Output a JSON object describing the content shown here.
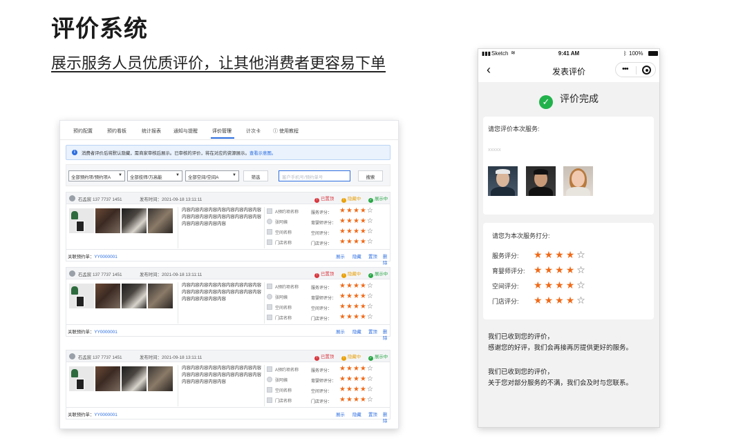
{
  "page": {
    "title": "评价系统",
    "subtitle": "展示服务人员优质评价，让其他消费者更容易下单"
  },
  "desktop": {
    "tabs": [
      {
        "label": "预约配置"
      },
      {
        "label": "预约看板"
      },
      {
        "label": "统计报表"
      },
      {
        "label": "通知与提醒"
      },
      {
        "label": "评价管理",
        "active": true
      },
      {
        "label": "计次卡"
      },
      {
        "label": "使用教程"
      }
    ],
    "notice": {
      "text": "消费者评价后将默认隐藏，需商家审核后展示。已审核的评价，将在对应的资源展示。",
      "link": "查看示意图。"
    },
    "filters": {
      "select1": "全部预约项/预约项A",
      "select2": "全部技师/万高能",
      "select3": "全部空间/空间A",
      "filter_button": "筛选",
      "search_placeholder": "客户手机号/预约单号",
      "search_button": "搜索"
    },
    "card": {
      "user": "石孟宸 137 7737 1451",
      "publish_time": "发布时间：2021-09-18 13:11:11",
      "status_pinned": "已置顶",
      "status_hidden": "隐藏中",
      "status_shown": "展示中",
      "content": "内容内容内容内容内容内容内容内容内容内容内容内容内容内容内容内容内容内容内容内容内容内容内容",
      "items": [
        "A预约项名称",
        "张阿姨",
        "空间名称",
        "门店名称"
      ],
      "score_labels": [
        "服务评分：",
        "育婴师评分：",
        "空间评分：",
        "门店评分："
      ],
      "score_value": 4,
      "score_max": 5,
      "order_label": "关联预约单：",
      "order_no": "YY0000001",
      "actions": [
        "展示",
        "隐藏",
        "置顶",
        "删除"
      ]
    },
    "card_count": 3
  },
  "phone": {
    "status_carrier": "Sketch",
    "status_time": "9:41 AM",
    "status_battery": "100%",
    "nav_title": "发表评价",
    "done_text": "评价完成",
    "review_prompt": "请您评价本次服务:",
    "review_placeholder": "xxxxx",
    "rating_prompt": "请您为本次服务打分:",
    "ratings": [
      {
        "label": "服务评分:",
        "value": 4,
        "max": 5
      },
      {
        "label": "育婴师评分:",
        "value": 4,
        "max": 5
      },
      {
        "label": "空间评分:",
        "value": 4,
        "max": 5
      },
      {
        "label": "门店评分:",
        "value": 4,
        "max": 5
      }
    ],
    "msg_positive_line1": "我们已收到您的评价，",
    "msg_positive_line2": "感谢您的好评，我们会再接再厉提供更好的服务。",
    "msg_negative_line1": "我们已收到您的评价，",
    "msg_negative_line2": "关于您对部分服务的不满，我们会及时与您联系。"
  }
}
